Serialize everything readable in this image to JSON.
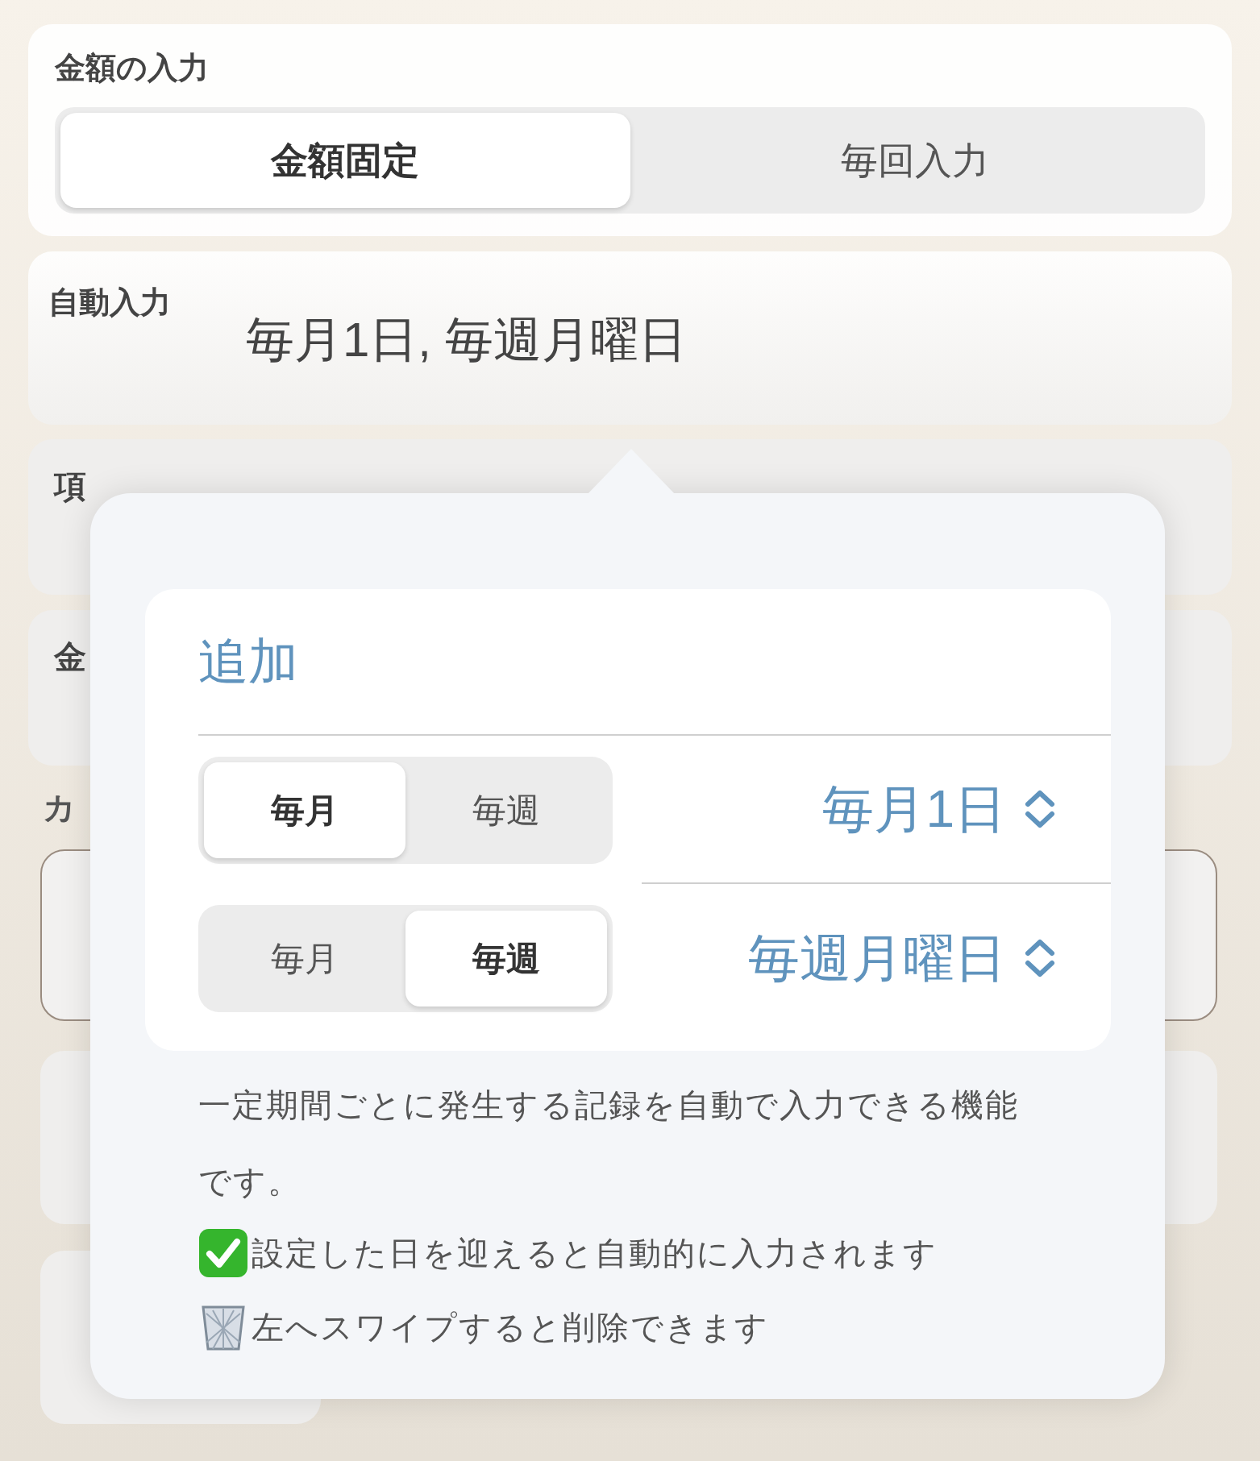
{
  "amount_input": {
    "title": "金額の入力",
    "segments": [
      {
        "label": "金額固定",
        "selected": true
      },
      {
        "label": "毎回入力",
        "selected": false
      }
    ]
  },
  "auto_input": {
    "label": "自動入力",
    "value": "毎月1日, 毎週月曜日"
  },
  "covered_cards": [
    {
      "label": "項"
    },
    {
      "label": "金"
    }
  ],
  "section_label": "カ",
  "popover": {
    "add_label": "追加",
    "rules": [
      {
        "segments": [
          {
            "label": "毎月",
            "selected": true
          },
          {
            "label": "毎週",
            "selected": false
          }
        ],
        "value": "毎月1日"
      },
      {
        "segments": [
          {
            "label": "毎月",
            "selected": false
          },
          {
            "label": "毎週",
            "selected": true
          }
        ],
        "value": "毎週月曜日"
      }
    ],
    "description": "一定期間ごとに発生する記録を自動で入力できる機能です。",
    "notes": [
      {
        "kind": "check",
        "text": "設定した日を迎えると自動的に入力されます"
      },
      {
        "kind": "trash",
        "text": "左へスワイプすると削除できます"
      }
    ]
  }
}
